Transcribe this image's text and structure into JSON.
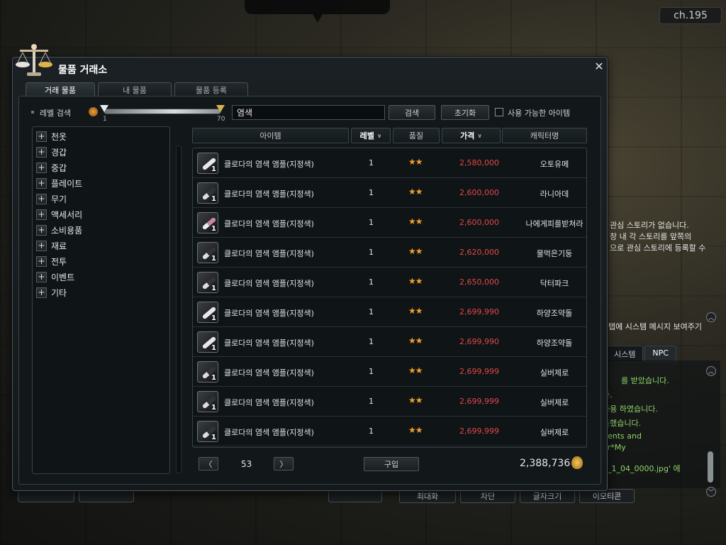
{
  "window": {
    "title": "물품 거래소",
    "close": "✕",
    "tabs": [
      "거래 물품",
      "내 물품",
      "물품 등록"
    ]
  },
  "filter": {
    "level_label": "레벨 검색",
    "level_min": "1",
    "level_max": "70",
    "search_value": "염색",
    "search_button": "검색",
    "reset_button": "초기화",
    "usable_only_label": "사용 가능한 아이템",
    "usable_only_checked": false
  },
  "categories": [
    "천옷",
    "경갑",
    "중갑",
    "플레이트",
    "무기",
    "액세서리",
    "소비용품",
    "재료",
    "전투",
    "이벤트",
    "기타"
  ],
  "table": {
    "headers": [
      "아이템",
      "레벨",
      "품질",
      "가격",
      "캐릭터명"
    ],
    "rows": [
      {
        "name": "클로다의 염색 앰플(지정색)",
        "qty": "1",
        "level": "1",
        "quality": "★★",
        "price": "2,580,000",
        "seller": "오토유메",
        "icon": "vial-white"
      },
      {
        "name": "클로다의 염색 앰플(지정색)",
        "qty": "1",
        "level": "1",
        "quality": "★★",
        "price": "2,600,000",
        "seller": "라니아데",
        "icon": "vial-dark"
      },
      {
        "name": "클로다의 염색 앰플(지정색)",
        "qty": "1",
        "level": "1",
        "quality": "★★",
        "price": "2,600,000",
        "seller": "나에게피를받쳐라",
        "icon": "vial-pink"
      },
      {
        "name": "클로다의 염색 앰플(지정색)",
        "qty": "1",
        "level": "1",
        "quality": "★★",
        "price": "2,620,000",
        "seller": "물먹은기둥",
        "icon": "vial-dark"
      },
      {
        "name": "클로다의 염색 앰플(지정색)",
        "qty": "1",
        "level": "1",
        "quality": "★★",
        "price": "2,650,000",
        "seller": "닥터파크",
        "icon": "vial-dark"
      },
      {
        "name": "클로다의 염색 앰플(지정색)",
        "qty": "1",
        "level": "1",
        "quality": "★★",
        "price": "2,699,990",
        "seller": "하양조약돌",
        "icon": "vial-white"
      },
      {
        "name": "클로다의 염색 앰플(지정색)",
        "qty": "1",
        "level": "1",
        "quality": "★★",
        "price": "2,699,990",
        "seller": "하양조약돌",
        "icon": "vial-white"
      },
      {
        "name": "클로다의 염색 앰플(지정색)",
        "qty": "1",
        "level": "1",
        "quality": "★★",
        "price": "2,699,999",
        "seller": "실버제로",
        "icon": "vial-dark"
      },
      {
        "name": "클로다의 염색 앰플(지정색)",
        "qty": "1",
        "level": "1",
        "quality": "★★",
        "price": "2,699,999",
        "seller": "실버제로",
        "icon": "vial-dark"
      },
      {
        "name": "클로다의 염색 앰플(지정색)",
        "qty": "1",
        "level": "1",
        "quality": "★★",
        "price": "2,699,999",
        "seller": "실버제로",
        "icon": "vial-dark"
      }
    ]
  },
  "footer": {
    "prev": "〈",
    "next": "〉",
    "page": "53",
    "buy_button": "구입",
    "gold": "2,388,736"
  },
  "hud": {
    "channel": "ch.195",
    "story_lines": [
      "관심 스토리가 없습니다.",
      "창 내 각 스토리를 앞쪽의",
      "으로 관심 스토리에 등록할 수"
    ],
    "system_msg_label": "탭에 시스템 메시지 보여주기",
    "chat_tabs": [
      "시스템",
      "NPC"
    ],
    "chat_lines": [
      "를 받았습니다.",
      "다.",
      "사용 하였습니다.",
      "득했습니다.",
      "nents and",
      "or*My",
      "1_1_04_0000.jpg' 에"
    ],
    "chat_buttons": [
      "최대화",
      "차단",
      "글자크기",
      "이모티콘"
    ],
    "left_buttons": [
      "",
      "",
      ""
    ]
  },
  "colors": {
    "price": "#e04848",
    "quality_star": "#f0a030",
    "chat_text": "#8fd36a"
  }
}
